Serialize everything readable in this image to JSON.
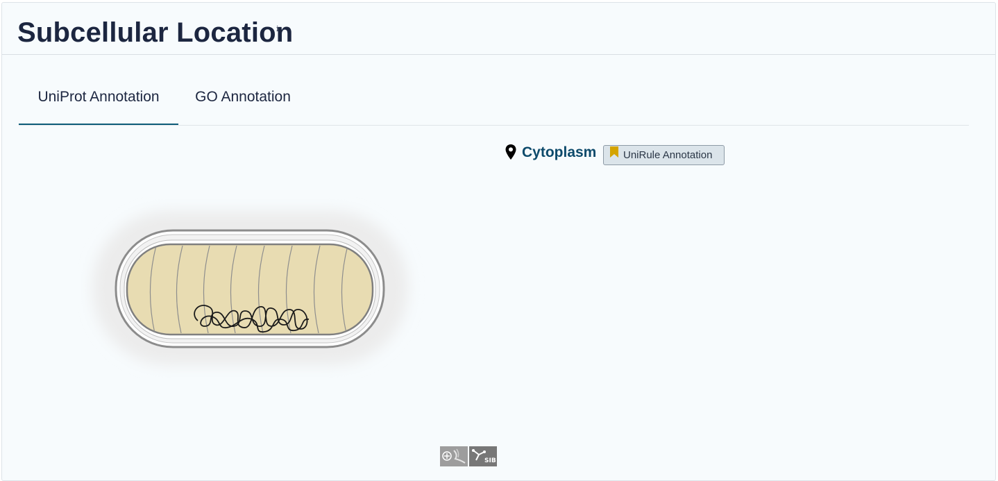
{
  "section": {
    "title": "Subcellular Location",
    "info_marker": "i"
  },
  "tabs": [
    {
      "label": "UniProt Annotation",
      "active": true
    },
    {
      "label": "GO Annotation",
      "active": false
    }
  ],
  "location": {
    "name": "Cytoplasm",
    "icon": "map-pin-icon",
    "evidence_badge": {
      "label": "UniRule Annotation",
      "icon": "bookmark-icon",
      "icon_color": "#d4a400"
    }
  },
  "illustration": {
    "subject": "bacterial-cell",
    "highlighted_compartment": "Cytoplasm",
    "cytoplasm_color": "#e8dcb2"
  },
  "logos": {
    "left": "swisslipids-logo",
    "right": {
      "label": "SIB",
      "icon": "sib-logo"
    }
  },
  "colors": {
    "accent": "#0d5c78",
    "title": "#1c2640",
    "link": "#0d4a6b"
  }
}
